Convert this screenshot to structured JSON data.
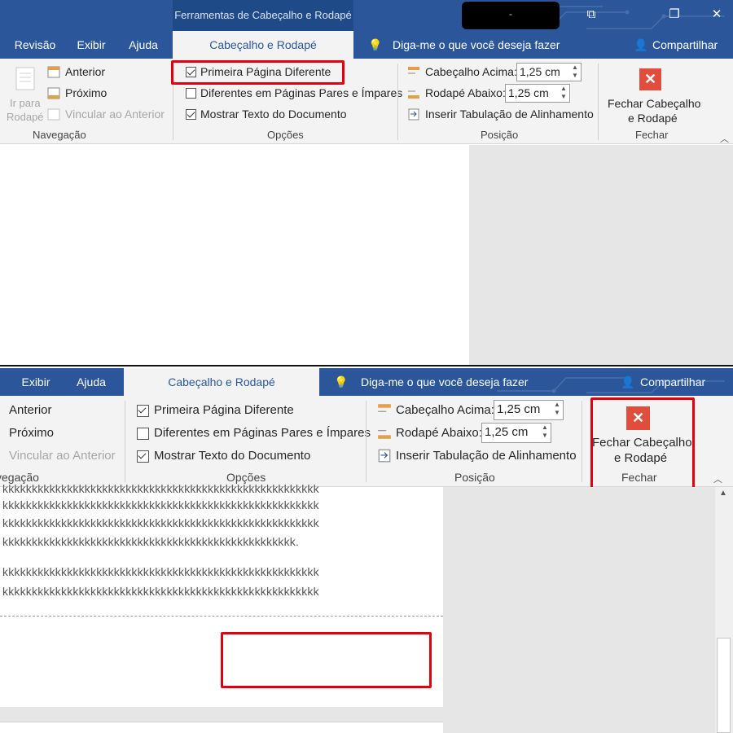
{
  "top": {
    "context_tab_title": "Ferramentas de Cabeçalho e Rodapé",
    "account_name": "-",
    "tabs": [
      "Revisão",
      "Exibir",
      "Ajuda",
      "Cabeçalho e Rodapé"
    ],
    "tell_me": "Diga-me o que você deseja fazer",
    "share": "Compartilhar",
    "nav": {
      "goto_footer_line1": "Ir para",
      "goto_footer_line2": "Rodapé",
      "previous": "Anterior",
      "next": "Próximo",
      "link_previous": "Vincular ao Anterior",
      "group_label": "Navegação"
    },
    "options": {
      "first_page": "Primeira Página Diferente",
      "first_page_checked": true,
      "odd_even": "Diferentes em Páginas Pares e Ímpares",
      "odd_even_checked": false,
      "show_text": "Mostrar Texto do Documento",
      "show_text_checked": true,
      "group_label": "Opções"
    },
    "position": {
      "header_top_label": "Cabeçalho Acima:",
      "header_top_value": "1,25 cm",
      "footer_bottom_label": "Rodapé Abaixo:",
      "footer_bottom_value": "1,25 cm",
      "insert_tab": "Inserir Tabulação de Alinhamento",
      "group_label": "Posição"
    },
    "close": {
      "line1": "Fechar Cabeçalho",
      "line2": "e Rodapé",
      "group_label": "Fechar"
    }
  },
  "bottom": {
    "tabs": [
      "Exibir",
      "Ajuda",
      "Cabeçalho e Rodapé"
    ],
    "tell_me": "Diga-me o que você deseja fazer",
    "share": "Compartilhar",
    "nav": {
      "previous": "Anterior",
      "next": "Próximo",
      "link_previous": "Vincular ao Anterior",
      "group_label": "vegação"
    },
    "options": {
      "first_page": "Primeira Página Diferente",
      "first_page_checked": true,
      "odd_even": "Diferentes em Páginas Pares e Ímpares",
      "odd_even_checked": false,
      "show_text": "Mostrar Texto do Documento",
      "show_text_checked": true,
      "group_label": "Opções"
    },
    "position": {
      "header_top_label": "Cabeçalho Acima:",
      "header_top_value": "1,25 cm",
      "footer_bottom_label": "Rodapé Abaixo:",
      "footer_bottom_value": "1,25 cm",
      "insert_tab": "Inserir Tabulação de Alinhamento",
      "group_label": "Posição"
    },
    "close": {
      "line1": "Fechar Cabeçalho",
      "line2": "e Rodapé",
      "group_label": "Fechar"
    },
    "doc_lines": [
      "kkkkkkkkkkkkkkkkkkkkkkkkkkkkkkkkkkkkkkkkkkkkkkkkkkkkkk",
      "kkkkkkkkkkkkkkkkkkkkkkkkkkkkkkkkkkkkkkkkkkkkkkkkkkkkkk",
      "kkkkkkkkkkkkkkkkkkkkkkkkkkkkkkkkkkkkkkkkkkkkkkkkkkkkkk",
      "kkkkkkkkkkkkkkkkkkkkkkkkkkkkkkkkkkkkkkkkkkkkkkkkkk.",
      "kkkkkkkkkkkkkkkkkkkkkkkkkkkkkkkkkkkkkkkkkkkkkkkkkkkkkk",
      "kkkkkkkkkkkkkkkkkkkkkkkkkkkkkkkkkkkkkkkkkkkkkkkkkkkkkk"
    ]
  },
  "colors": {
    "ribbon_blue": "#2b579a",
    "ribbon_bg": "#f3f3f3",
    "highlight_red": "#e0000f",
    "close_icon_red": "#e14d3c"
  }
}
